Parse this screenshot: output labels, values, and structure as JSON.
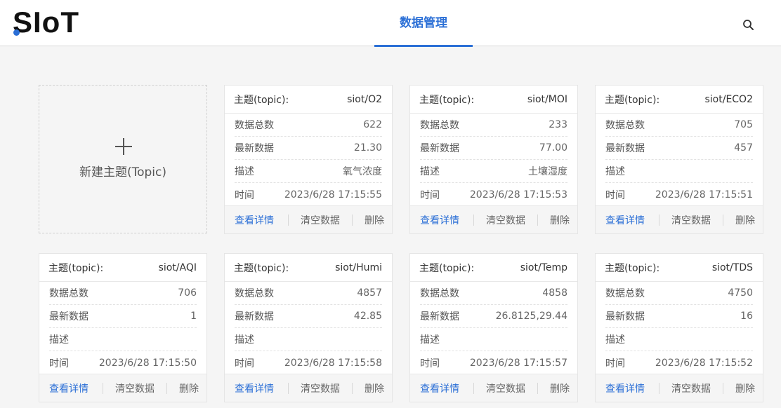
{
  "app": {
    "logo_text": "SIoT",
    "nav_tab": "数据管理"
  },
  "new_topic": {
    "label": "新建主题(Topic)"
  },
  "labels": {
    "topic": "主题(topic):",
    "total": "数据总数",
    "latest": "最新数据",
    "desc": "描述",
    "time": "时间",
    "view": "查看详情",
    "clear": "清空数据",
    "delete": "删除"
  },
  "topics": [
    {
      "name": "siot/O2",
      "total": "622",
      "latest": "21.30",
      "desc": "氧气浓度",
      "time": "2023/6/28 17:15:55"
    },
    {
      "name": "siot/MOI",
      "total": "233",
      "latest": "77.00",
      "desc": "土壤湿度",
      "time": "2023/6/28 17:15:53"
    },
    {
      "name": "siot/ECO2",
      "total": "705",
      "latest": "457",
      "desc": "",
      "time": "2023/6/28 17:15:51"
    },
    {
      "name": "siot/AQI",
      "total": "706",
      "latest": "1",
      "desc": "",
      "time": "2023/6/28 17:15:50"
    },
    {
      "name": "siot/Humi",
      "total": "4857",
      "latest": "42.85",
      "desc": "",
      "time": "2023/6/28 17:15:58"
    },
    {
      "name": "siot/Temp",
      "total": "4858",
      "latest": "26.8125,29.44",
      "desc": "",
      "time": "2023/6/28 17:15:57"
    },
    {
      "name": "siot/TDS",
      "total": "4750",
      "latest": "16",
      "desc": "",
      "time": "2023/6/28 17:15:52"
    }
  ],
  "colors": {
    "accent": "#2b6fd6",
    "background": "#f5f5f5"
  }
}
